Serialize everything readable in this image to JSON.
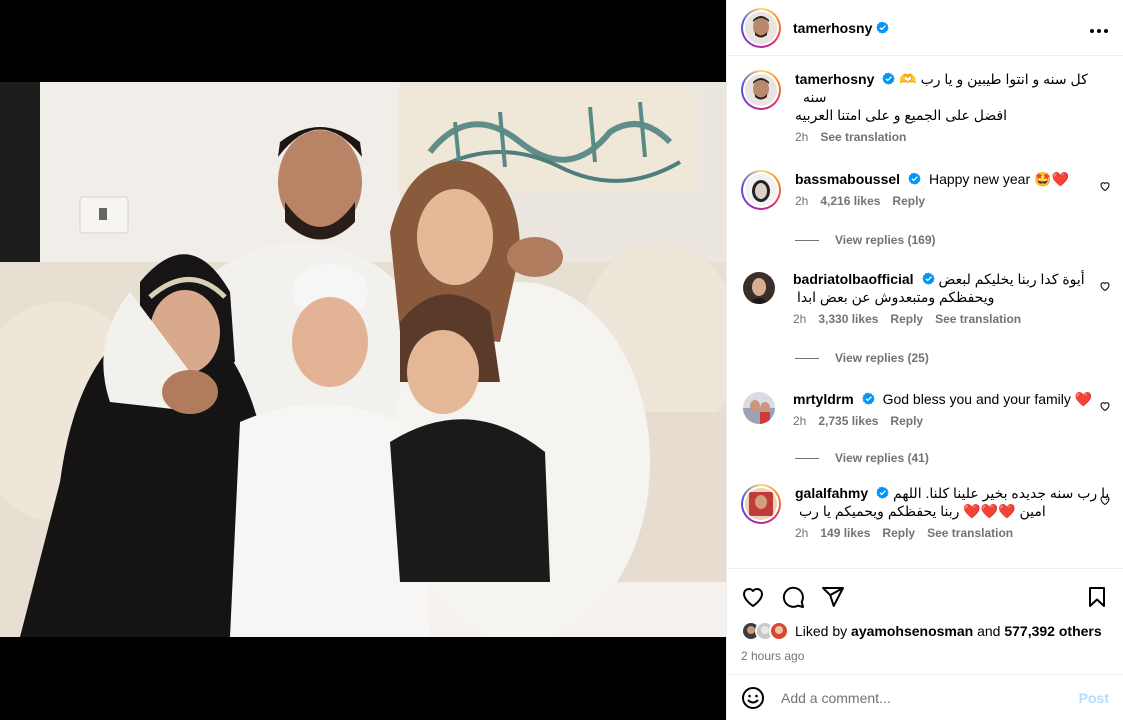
{
  "post": {
    "author": "tamerhosny",
    "caption_line1": "كل سنه و انتوا طيبين و يا رب 🫶 سنه",
    "caption_line2": "افضل على الجميع و على امتنا العربيه",
    "caption_time": "2h",
    "see_translation": "See translation"
  },
  "comments": [
    {
      "user": "bassmaboussel",
      "text": "Happy new year 🤩❤️",
      "time": "2h",
      "likes": "4,216 likes",
      "reply": "Reply",
      "view_replies": "View replies (169)"
    },
    {
      "user": "badriatolbaofficial",
      "text": "أيوة كدا ربنا يخليكم لبعض ويحفظكم ومتبعدوش عن بعض ابدا",
      "time": "2h",
      "likes": "3,330 likes",
      "reply": "Reply",
      "see_translation": "See translation",
      "view_replies": "View replies (25)"
    },
    {
      "user": "mrtyldrm",
      "text": "God bless you and your family ❤️",
      "time": "2h",
      "likes": "2,735 likes",
      "reply": "Reply",
      "view_replies": "View replies (41)"
    },
    {
      "user": "galalfahmy",
      "text": "يا رب سنه جديده بخير علينا كلنا. اللهم امين ❤️❤️❤️ ربنا يحفظكم ويحميكم يا رب",
      "time": "2h",
      "likes": "149 likes",
      "reply": "Reply",
      "see_translation": "See translation"
    }
  ],
  "likes_summary": {
    "prefix": "Liked by",
    "user": "ayamohsenosman",
    "and": "and",
    "count": "577,392 others"
  },
  "post_time": "2 hours ago",
  "add_comment": {
    "placeholder": "Add a comment...",
    "post_label": "Post"
  },
  "colors": {
    "verified": "#0095f6",
    "heart_red": "#ed4956",
    "post_disabled": "#b2dffc",
    "muted_text": "#737373"
  },
  "icons": [
    "more-options-icon",
    "verified-icon",
    "heart-icon",
    "comment-icon",
    "share-icon",
    "save-icon",
    "emoji-icon"
  ]
}
